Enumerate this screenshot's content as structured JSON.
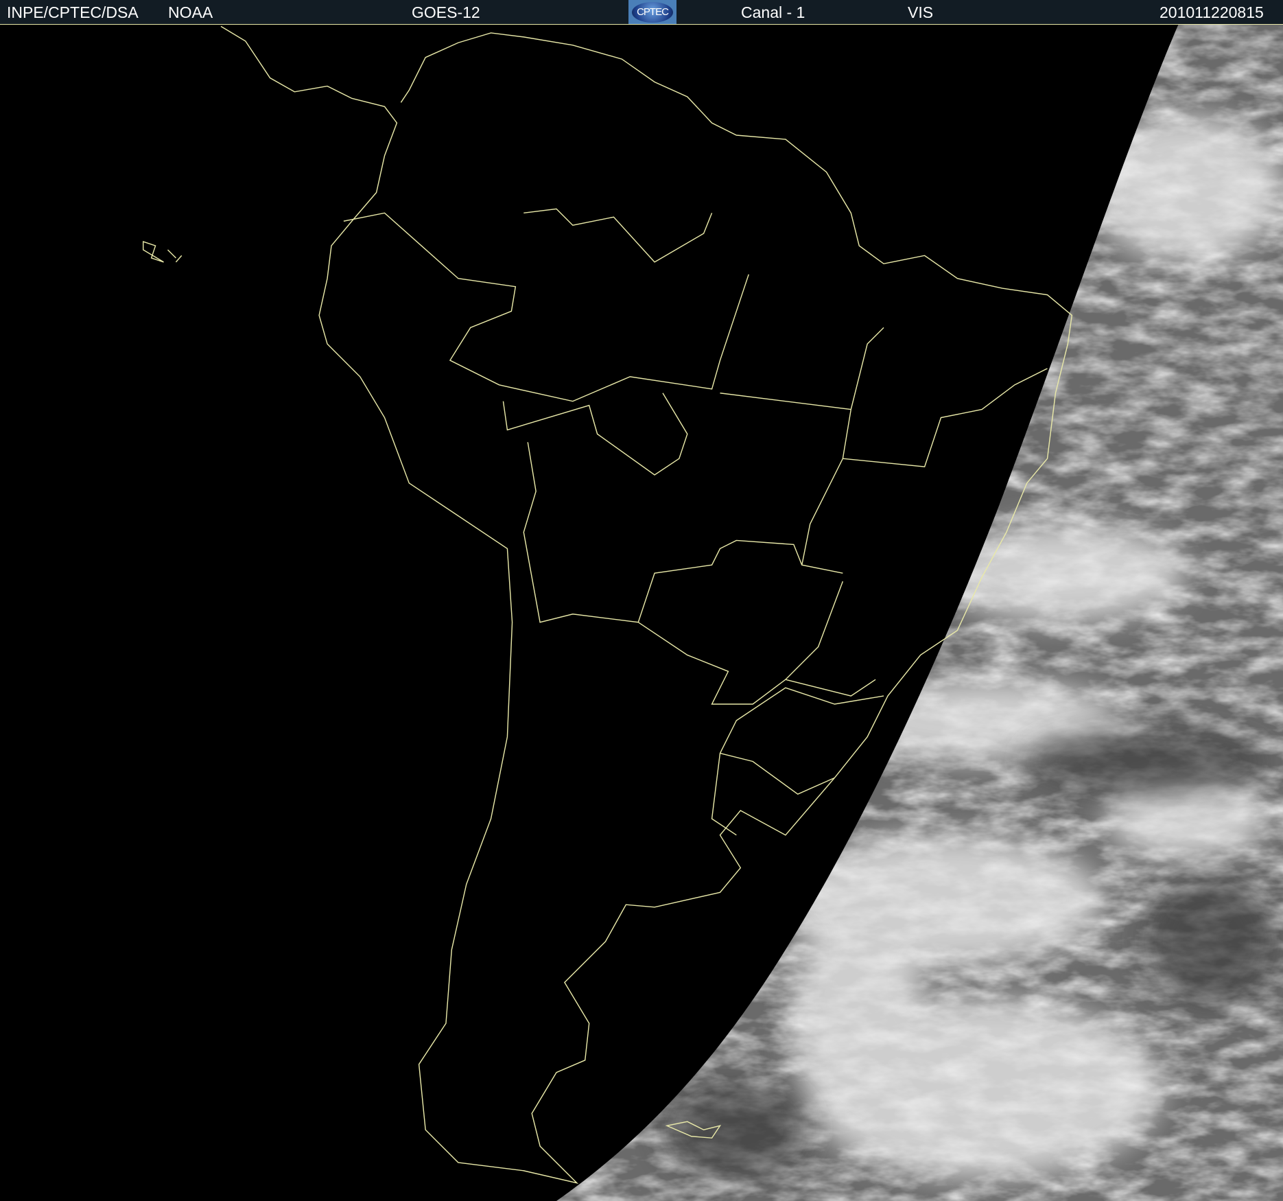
{
  "header": {
    "institution": "INPE/CPTEC/DSA",
    "agency": "NOAA",
    "satellite": "GOES-12",
    "logo_text": "CPTEC",
    "channel": "Canal - 1",
    "band": "VIS",
    "timestamp": "201011220815"
  },
  "colors": {
    "header_bg": "#121c24",
    "coastline": "#e8e8a8",
    "night": "#000000"
  }
}
